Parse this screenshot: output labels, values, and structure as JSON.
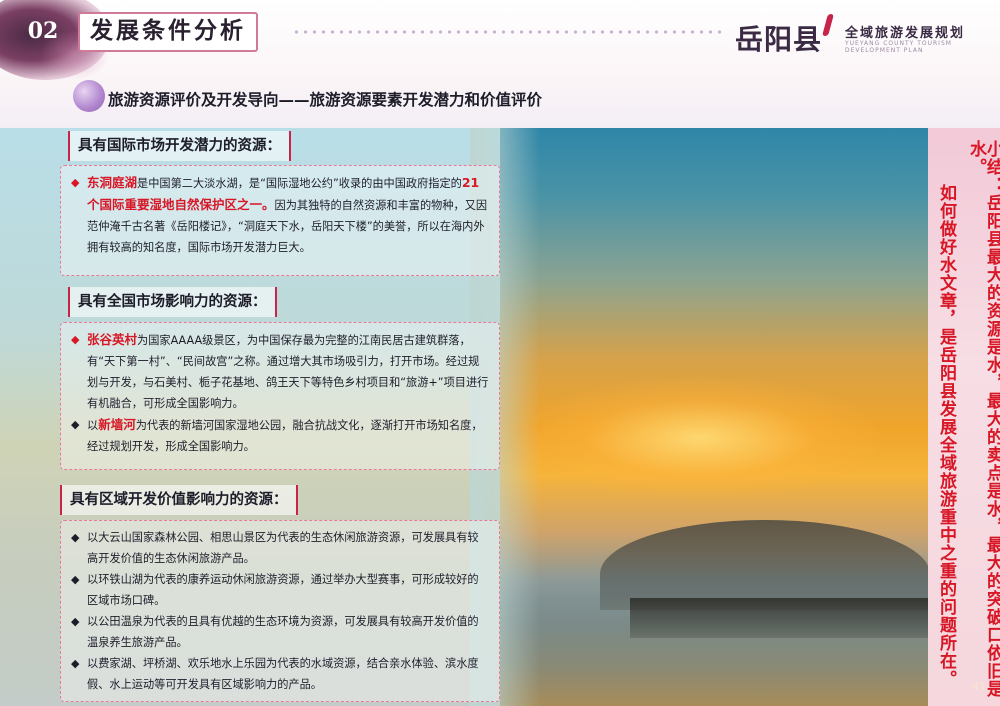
{
  "header": {
    "section_number": "02",
    "section_title": "发展条件分析",
    "logo_text": "岳阳县",
    "plan_title": "全域旅游发展规划",
    "plan_subtitle": "YUEYANG COUNTY TOURISM DEVELOPMENT PLAN",
    "subtitle": "旅游资源评价及开发导向——旅游资源要素开发潜力和价值评价"
  },
  "sections": {
    "international": {
      "heading": "具有国际市场开发潜力的资源：",
      "item1": {
        "bullet": "◆",
        "lead": "东洞庭湖",
        "text1": "是中国第二大淡水湖，是“国际湿地公约”收录的由中国政府指定的",
        "highlight": "21个国际重要湿地自然保护区之一。",
        "text2": "因为其独特的自然资源和丰富的物种，又因范仲淹千古名著《岳阳楼记》，“洞庭天下水，岳阳天下楼”的美誉，所以在海内外拥有较高的知名度，国际市场开发潜力巨大。"
      }
    },
    "national": {
      "heading": "具有全国市场影响力的资源：",
      "item1": {
        "bullet": "◆",
        "lead": "张谷英村",
        "text": "为国家AAAA级景区，为中国保存最为完整的江南民居古建筑群落，有“天下第一村”、“民间故宫”之称。通过增大其市场吸引力，打开市场。经过规划与开发，与石美村、栀子花基地、鸽王天下等特色乡村项目和“旅游+”项目进行有机融合，可形成全国影响力。"
      },
      "item2": {
        "bullet": "◆",
        "pre": "以",
        "lead": "新墙河",
        "text": "为代表的新墙河国家湿地公园，融合抗战文化，逐渐打开市场知名度，经过规划开发，形成全国影响力。"
      }
    },
    "regional": {
      "heading": "具有区域开发价值影响力的资源：",
      "items": [
        {
          "bullet": "◆",
          "text": "以大云山国家森林公园、相思山景区为代表的生态休闲旅游资源，可发展具有较高开发价值的生态休闲旅游产品。"
        },
        {
          "bullet": "◆",
          "text": "以环铁山湖为代表的康养运动休闲旅游资源，通过举办大型赛事，可形成较好的区域市场口碑。"
        },
        {
          "bullet": "◆",
          "text": "以公田温泉为代表的且具有优越的生态环境为资源，可发展具有较高开发价值的温泉养生旅游产品。"
        },
        {
          "bullet": "◆",
          "text": "以费家湖、坪桥湖、欢乐地水上乐园为代表的水域资源，结合亲水体验、滨水度假、水上运动等可开发具有区域影响力的产品。"
        }
      ]
    }
  },
  "summary": {
    "col1": "小结：岳阳县最大的资源是水，最大的卖点是水，最大的突破口依旧是水。",
    "col2": "如何做好水文章，是岳阳县发展全域旅游重中之重的问题所在。"
  },
  "page_number": "41",
  "colors": {
    "accent_red": "#d81726",
    "frame_pink": "#e87a98",
    "title_dark": "#2a2030"
  }
}
